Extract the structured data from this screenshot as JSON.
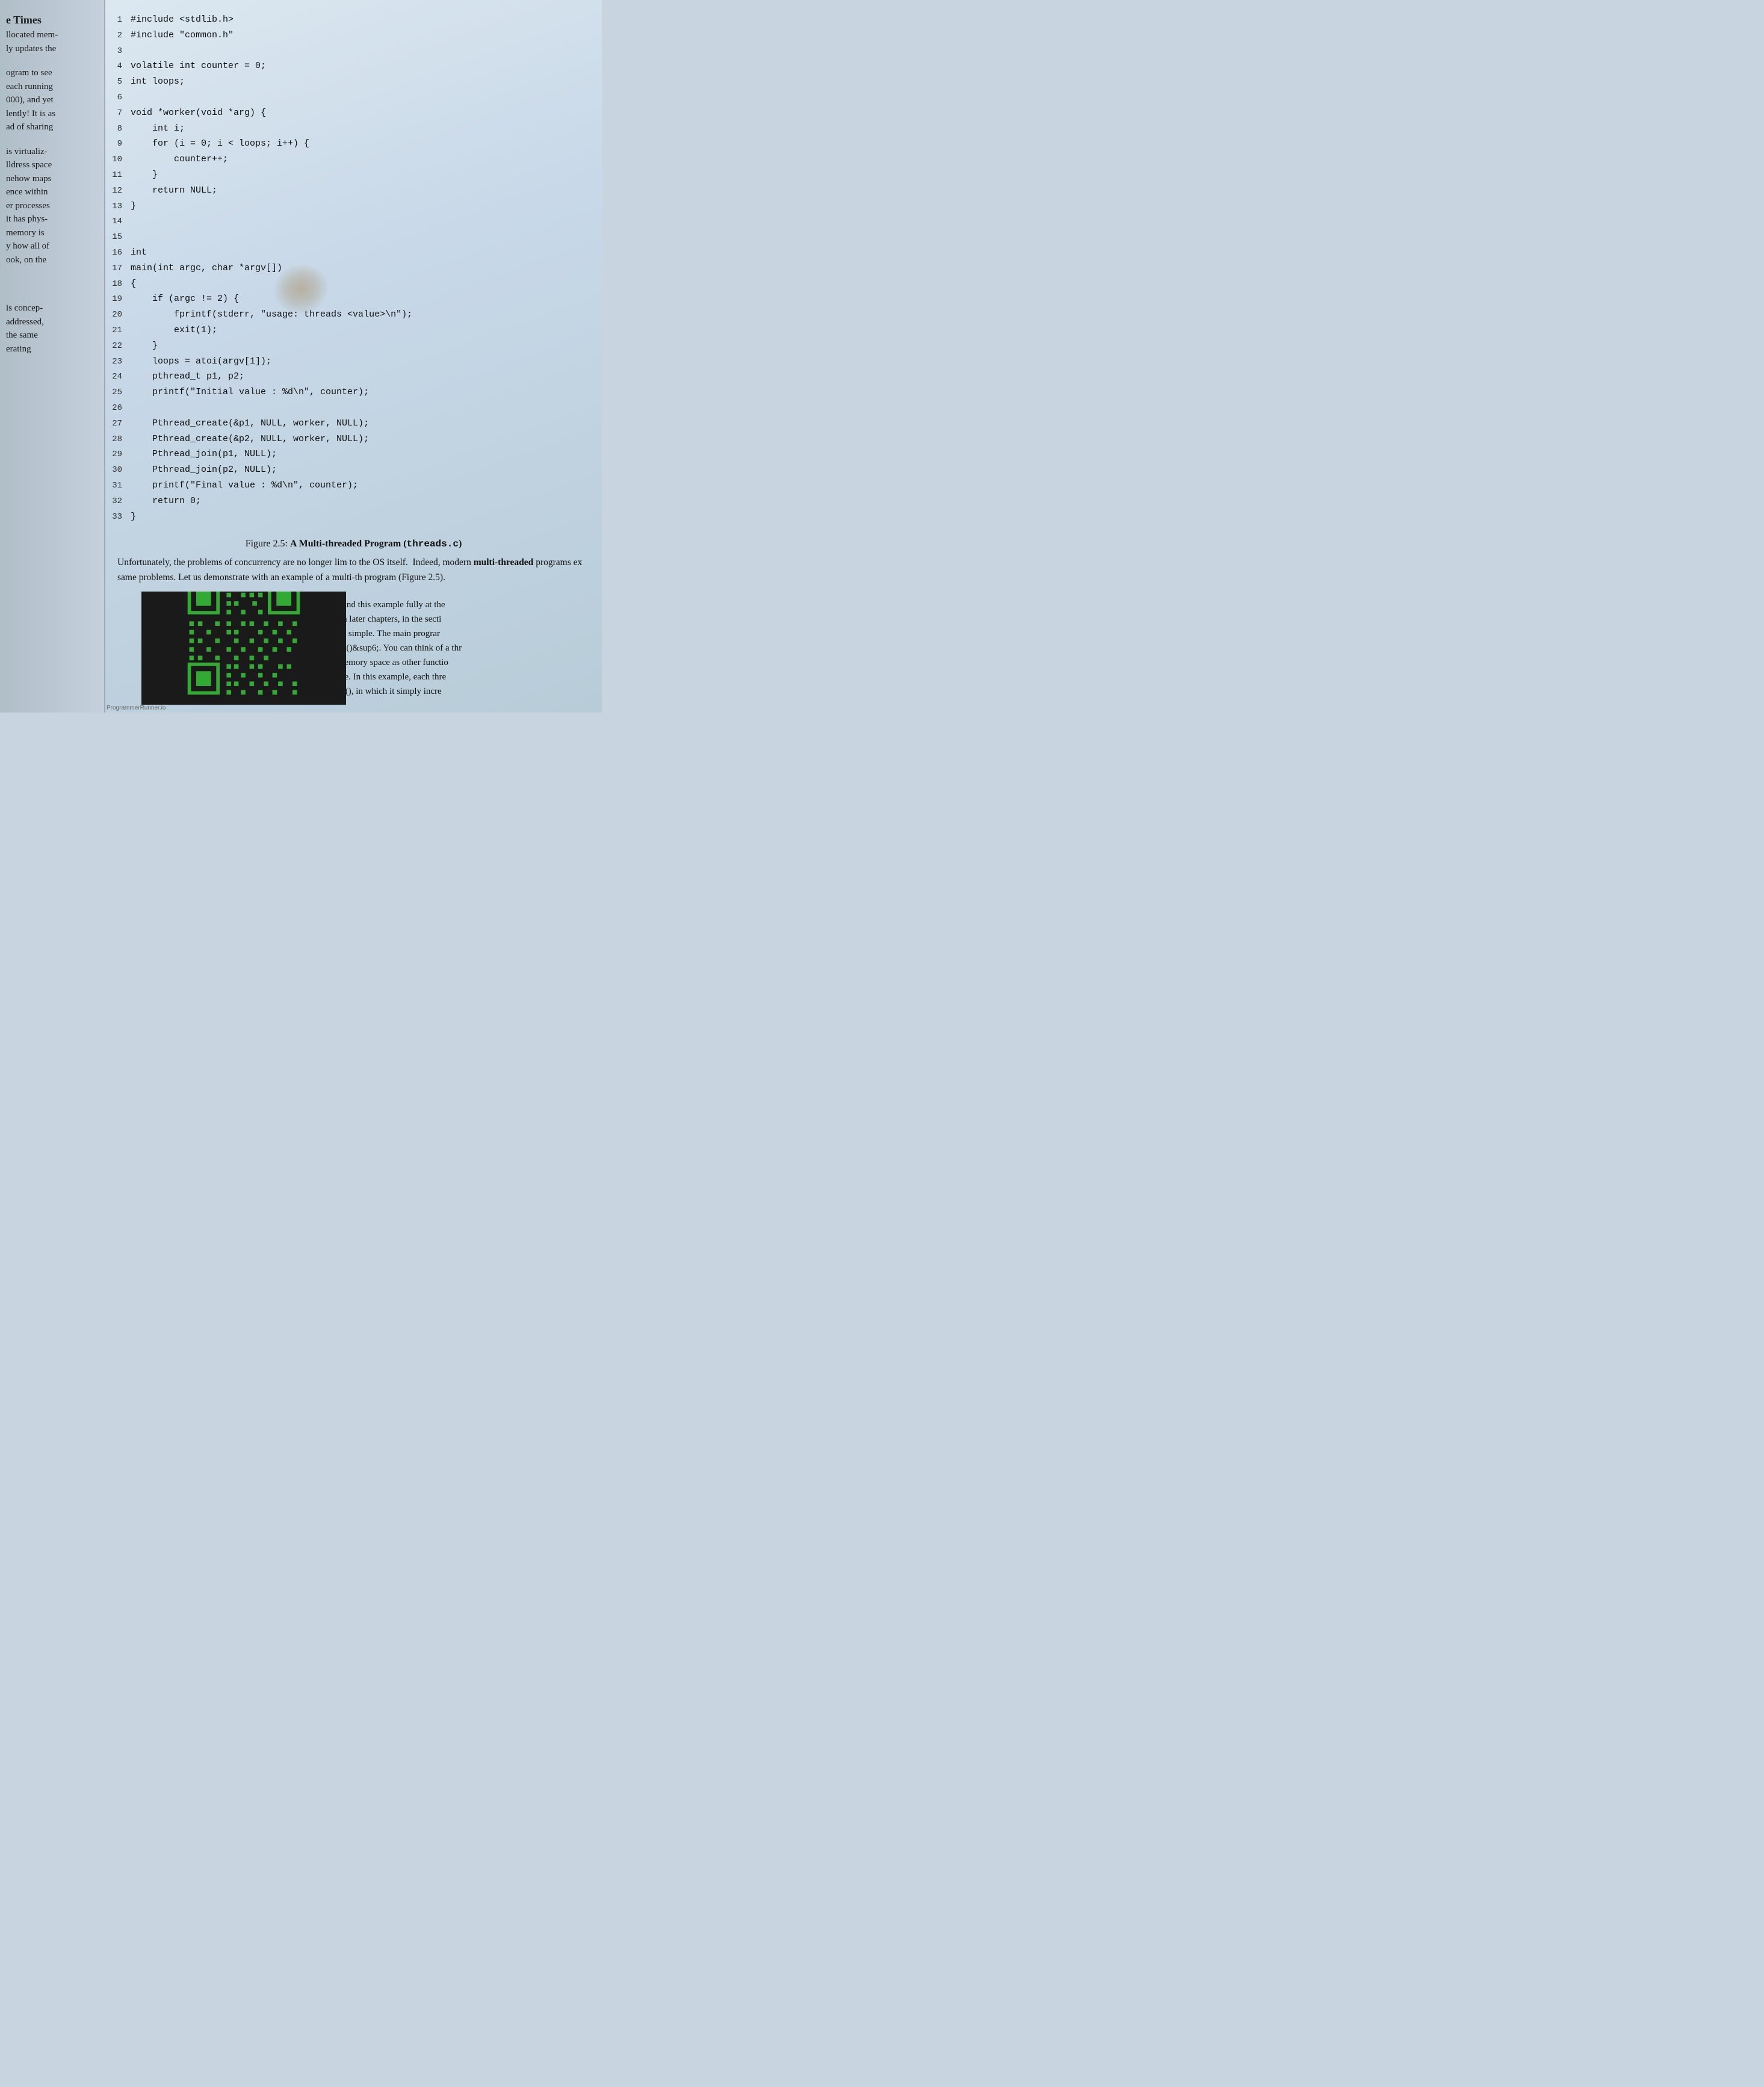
{
  "left_page": {
    "blocks": [
      {
        "heading": "e Times",
        "lines": [
          "llocated mem-",
          "ly updates the"
        ]
      },
      {
        "lines": [
          "ogram to see",
          "each running",
          "000), and yet",
          "lently! It is as",
          "ad of sharing"
        ]
      },
      {
        "lines": [
          "is virtualiz-",
          "lldress space",
          "nehow maps",
          "ence within",
          "er processes",
          "it has phys-",
          "memory is",
          "y how all of",
          "ook, on the"
        ]
      },
      {
        "lines": [
          "is concep-",
          "addressed,",
          "the same",
          "erating"
        ]
      }
    ]
  },
  "code": {
    "lines": [
      {
        "num": "1",
        "text": "#include <stdlib.h>"
      },
      {
        "num": "2",
        "text": "#include \"common.h\""
      },
      {
        "num": "3",
        "text": ""
      },
      {
        "num": "4",
        "text": "volatile int counter = 0;"
      },
      {
        "num": "5",
        "text": "int loops;"
      },
      {
        "num": "6",
        "text": ""
      },
      {
        "num": "7",
        "text": "void *worker(void *arg) {"
      },
      {
        "num": "8",
        "text": "    int i;"
      },
      {
        "num": "9",
        "text": "    for (i = 0; i < loops; i++) {"
      },
      {
        "num": "10",
        "text": "        counter++;"
      },
      {
        "num": "11",
        "text": "    }"
      },
      {
        "num": "12",
        "text": "    return NULL;"
      },
      {
        "num": "13",
        "text": "}"
      },
      {
        "num": "14",
        "text": ""
      },
      {
        "num": "15",
        "text": ""
      },
      {
        "num": "16",
        "text": "int"
      },
      {
        "num": "17",
        "text": "main(int argc, char *argv[])"
      },
      {
        "num": "18",
        "text": "{"
      },
      {
        "num": "19",
        "text": "    if (argc != 2) {"
      },
      {
        "num": "20",
        "text": "        fprintf(stderr, \"usage: threads <value>\\n\");"
      },
      {
        "num": "21",
        "text": "        exit(1);"
      },
      {
        "num": "22",
        "text": "    }"
      },
      {
        "num": "23",
        "text": "    loops = atoi(argv[1]);"
      },
      {
        "num": "24",
        "text": "    pthread_t p1, p2;"
      },
      {
        "num": "25",
        "text": "    printf(\"Initial value : %d\\n\", counter);"
      },
      {
        "num": "26",
        "text": ""
      },
      {
        "num": "27",
        "text": "    Pthread_create(&p1, NULL, worker, NULL);"
      },
      {
        "num": "28",
        "text": "    Pthread_create(&p2, NULL, worker, NULL);"
      },
      {
        "num": "29",
        "text": "    Pthread_join(p1, NULL);"
      },
      {
        "num": "30",
        "text": "    Pthread_join(p2, NULL);"
      },
      {
        "num": "31",
        "text": "    printf(\"Final value   : %d\\n\", counter);"
      },
      {
        "num": "32",
        "text": "    return 0;"
      },
      {
        "num": "33",
        "text": "}"
      }
    ]
  },
  "figure_caption": {
    "text": "Figure 2.5: A Multi-threaded Program (",
    "code": "threads.c",
    "text_end": ")"
  },
  "body_text_1": "Unfortunately, the problems of concurrency are no longer lim to the OS itself.  Indeed, modern ",
  "body_text_1_bold": "multi-threaded",
  "body_text_1_end": " programs ex same problems. Let us demonstrate with an example of a multi-th program (Figure 2.5).",
  "body_text_2": "tand this example fully at the in later chapters, in the secti is simple. The main prograr e ()6. You can think of a thr hemory space as other functio ne. In this example, each thre r (), in which it simply incre",
  "watermark": "ProgrammerRunner.io"
}
